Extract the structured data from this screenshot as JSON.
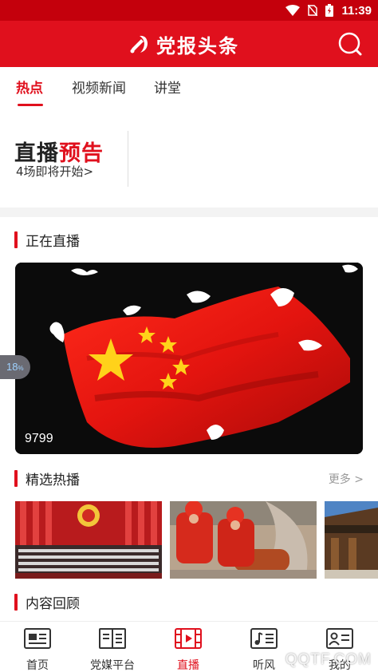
{
  "status_bar": {
    "time": "11:39"
  },
  "header": {
    "title": "党报头条",
    "emblem_icon": "party-emblem-icon",
    "search_icon": "search-icon"
  },
  "tabs": [
    {
      "label": "热点",
      "active": true
    },
    {
      "label": "视频新闻",
      "active": false
    },
    {
      "label": "讲堂",
      "active": false
    }
  ],
  "live_preview": {
    "logo_part1": "直播",
    "logo_part2": "预告",
    "subtitle": "4场即将开始>"
  },
  "live_now": {
    "title": "正在直播",
    "viewer_count": "9799"
  },
  "float_badge": {
    "value": "18",
    "unit": "%"
  },
  "featured": {
    "title": "精选热播",
    "more": "更多 >"
  },
  "review": {
    "title": "内容回顾"
  },
  "bottom_nav": [
    {
      "label": "首页",
      "icon": "home-news-icon",
      "active": false
    },
    {
      "label": "党媒平台",
      "icon": "media-platform-icon",
      "active": false
    },
    {
      "label": "直播",
      "icon": "live-video-icon",
      "active": true
    },
    {
      "label": "听风",
      "icon": "music-list-icon",
      "active": false
    },
    {
      "label": "我的",
      "icon": "profile-card-icon",
      "active": false
    }
  ],
  "watermark": "QQTF.COM",
  "colors": {
    "brand_red": "#e0101d",
    "status_red": "#c4000c",
    "text": "#222222",
    "muted": "#999999"
  }
}
